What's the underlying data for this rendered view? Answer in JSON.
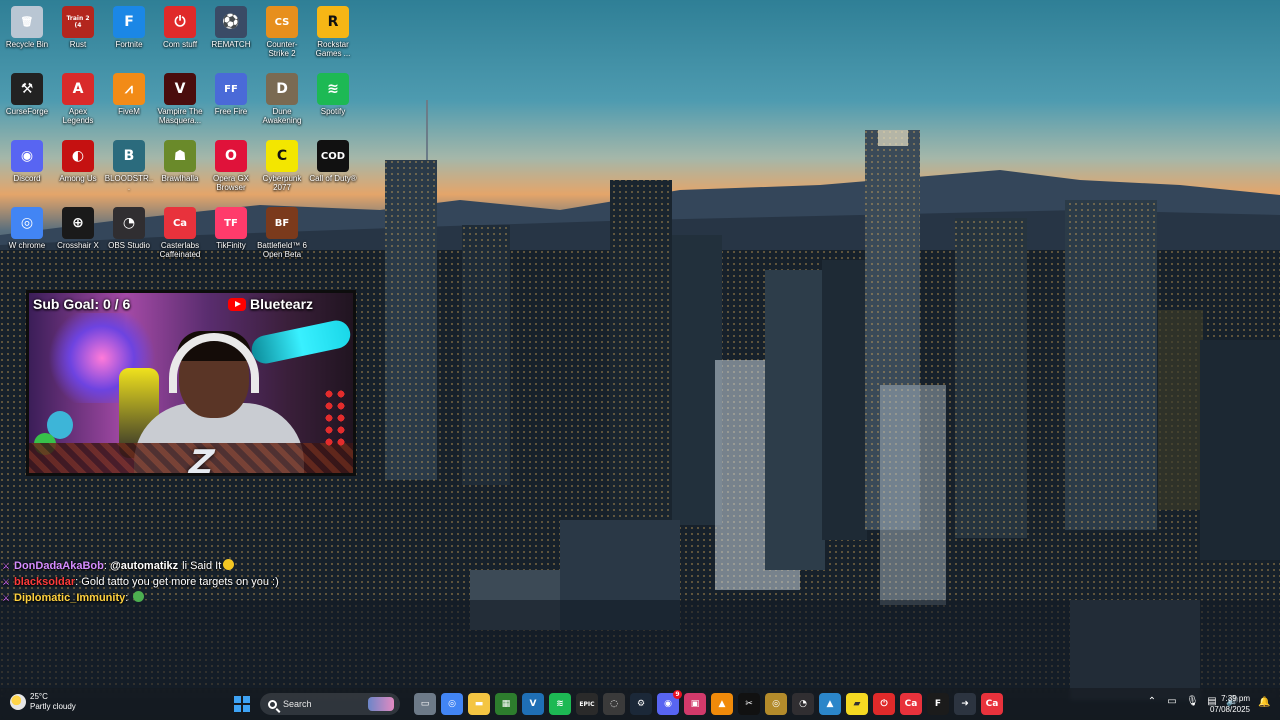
{
  "desktop": {
    "icons": [
      {
        "label": "Recycle Bin",
        "icon": "recycle-bin-icon",
        "color": "#b9c6d3",
        "glyph": "🗑",
        "shortcut": false,
        "col": 0,
        "row": 0
      },
      {
        "label": "Rust",
        "icon": "rust-icon",
        "color": "#b3261e",
        "glyph": "Train 2 (4",
        "shortcut": true,
        "col": 1,
        "row": 0
      },
      {
        "label": "Fortnite",
        "icon": "fortnite-icon",
        "color": "#1b87e6",
        "glyph": "F",
        "shortcut": true,
        "col": 2,
        "row": 0
      },
      {
        "label": "Com stuff",
        "icon": "power-icon",
        "color": "#e02a2a",
        "glyph": "⏻",
        "shortcut": false,
        "col": 3,
        "row": 0
      },
      {
        "label": "REMATCH",
        "icon": "rematch-icon",
        "color": "#3a4b66",
        "glyph": "⚽",
        "shortcut": true,
        "col": 4,
        "row": 0
      },
      {
        "label": "Counter-Strike 2",
        "icon": "counter-strike-icon",
        "color": "#e78f1d",
        "glyph": "CS",
        "shortcut": true,
        "col": 5,
        "row": 0
      },
      {
        "label": "Rockstar Games ...",
        "icon": "rockstar-icon",
        "color": "#f6b615",
        "glyph": "R",
        "shortcut": true,
        "col": 6,
        "row": 0
      },
      {
        "label": "CurseForge",
        "icon": "curseforge-icon",
        "color": "#222222",
        "glyph": "⚒",
        "shortcut": true,
        "col": 0,
        "row": 1
      },
      {
        "label": "Apex Legends",
        "icon": "apex-icon",
        "color": "#d92a2a",
        "glyph": "A",
        "shortcut": true,
        "col": 1,
        "row": 1
      },
      {
        "label": "FiveM",
        "icon": "fivem-icon",
        "color": "#f28b17",
        "glyph": "⩘",
        "shortcut": true,
        "col": 2,
        "row": 1
      },
      {
        "label": "Vampire The Masquera...",
        "icon": "vampire-icon",
        "color": "#4a0d0d",
        "glyph": "V",
        "shortcut": true,
        "col": 3,
        "row": 1
      },
      {
        "label": "Free Fire",
        "icon": "free-fire-icon",
        "color": "#4a6ad8",
        "glyph": "FF",
        "shortcut": true,
        "col": 4,
        "row": 1
      },
      {
        "label": "Dune Awakening",
        "icon": "dune-icon",
        "color": "#7a6a52",
        "glyph": "D",
        "shortcut": true,
        "col": 5,
        "row": 1
      },
      {
        "label": "Spotify",
        "icon": "spotify-icon",
        "color": "#1db954",
        "glyph": "≋",
        "shortcut": false,
        "col": 6,
        "row": 1
      },
      {
        "label": "Discord",
        "icon": "discord-icon",
        "color": "#5865f2",
        "glyph": "◉",
        "shortcut": false,
        "col": 0,
        "row": 2
      },
      {
        "label": "Among Us",
        "icon": "among-us-icon",
        "color": "#c51111",
        "glyph": "◐",
        "shortcut": true,
        "col": 1,
        "row": 2
      },
      {
        "label": "BLOODSTR...",
        "icon": "bloodstrike-icon",
        "color": "#2b6b7d",
        "glyph": "B",
        "shortcut": true,
        "col": 2,
        "row": 2
      },
      {
        "label": "Brawlhalla",
        "icon": "brawlhalla-icon",
        "color": "#6a8a2a",
        "glyph": "☗",
        "shortcut": true,
        "col": 3,
        "row": 2
      },
      {
        "label": "Opera GX Browser",
        "icon": "opera-gx-icon",
        "color": "#e0123a",
        "glyph": "O",
        "shortcut": true,
        "col": 4,
        "row": 2
      },
      {
        "label": "Cyberpunk 2077",
        "icon": "cyberpunk-icon",
        "color": "#f3e600",
        "glyph": "C",
        "shortcut": true,
        "col": 5,
        "row": 2
      },
      {
        "label": "Call of Duty®",
        "icon": "call-of-duty-icon",
        "color": "#111111",
        "glyph": "COD",
        "shortcut": true,
        "col": 6,
        "row": 2
      },
      {
        "label": "W chrome",
        "icon": "chrome-icon",
        "color": "#4285f4",
        "glyph": "◎",
        "shortcut": false,
        "col": 0,
        "row": 3
      },
      {
        "label": "Crosshair X",
        "icon": "crosshair-icon",
        "color": "#1a1a1a",
        "glyph": "⊕",
        "shortcut": true,
        "col": 1,
        "row": 3
      },
      {
        "label": "OBS Studio",
        "icon": "obs-icon",
        "color": "#302e31",
        "glyph": "◔",
        "shortcut": true,
        "col": 2,
        "row": 3
      },
      {
        "label": "Casterlabs Caffeinated",
        "icon": "casterlabs-icon",
        "color": "#e8323c",
        "glyph": "Ca",
        "shortcut": true,
        "col": 3,
        "row": 3
      },
      {
        "label": "TikFinity",
        "icon": "tikfinity-icon",
        "color": "#ff3b6b",
        "glyph": "TF",
        "shortcut": true,
        "col": 4,
        "row": 3
      },
      {
        "label": "Battlefield™ 6 Open Beta",
        "icon": "battlefield-icon",
        "color": "#7b3a1c",
        "glyph": "BF",
        "shortcut": true,
        "col": 5,
        "row": 3
      }
    ]
  },
  "stream": {
    "sub_goal": "Sub Goal: 0 / 6",
    "channel": "Bluetearz",
    "logo_letter": "Z"
  },
  "chat": [
    {
      "user": "DonDadaAkaBob",
      "user_color": "#d48cff",
      "message": "@automatikz",
      "message_bold": true,
      "extra": "li Said It",
      "emoji": "grinning",
      "badge": "⚔"
    },
    {
      "user": "blacksoldar",
      "user_color": "#ff3b3b",
      "message": "Gold tatto you get more targets on you :)",
      "message_bold": false,
      "extra": "",
      "emoji": "",
      "badge": "⚔"
    },
    {
      "user": "Diplomatic_Immunity",
      "user_color": "#ffd23f",
      "message": "",
      "message_bold": false,
      "extra": "",
      "emoji": "green",
      "badge": "⚔"
    }
  ],
  "taskbar": {
    "weather_temp": "25°C",
    "weather_desc": "Partly cloudy",
    "search_label": "Search",
    "apps": [
      {
        "icon": "task-view-icon",
        "color": "#6d7a88",
        "glyph": "▭",
        "badge": ""
      },
      {
        "icon": "chrome-icon",
        "color": "#4285f4",
        "glyph": "◎",
        "badge": ""
      },
      {
        "icon": "file-explorer-icon",
        "color": "#f4c542",
        "glyph": "▬",
        "badge": ""
      },
      {
        "icon": "terminal-icon",
        "color": "#2d7d2d",
        "glyph": "▦",
        "badge": ""
      },
      {
        "icon": "vscode-icon",
        "color": "#1f6fb5",
        "glyph": "V",
        "badge": ""
      },
      {
        "icon": "spotify-icon",
        "color": "#1db954",
        "glyph": "≋",
        "badge": ""
      },
      {
        "icon": "epic-games-icon",
        "color": "#2a2a2a",
        "glyph": "EPIC",
        "badge": ""
      },
      {
        "icon": "settings-ring-icon",
        "color": "#3a3a3a",
        "glyph": "◌",
        "badge": ""
      },
      {
        "icon": "steam-icon",
        "color": "#1b2838",
        "glyph": "⚙",
        "badge": ""
      },
      {
        "icon": "discord-icon",
        "color": "#5865f2",
        "glyph": "◉",
        "badge": "9"
      },
      {
        "icon": "photos-icon",
        "color": "#d23a6b",
        "glyph": "▣",
        "badge": ""
      },
      {
        "icon": "vlc-icon",
        "color": "#f08a0a",
        "glyph": "▲",
        "badge": ""
      },
      {
        "icon": "capcut-icon",
        "color": "#111111",
        "glyph": "✂",
        "badge": ""
      },
      {
        "icon": "gold-ring-icon",
        "color": "#b38b2b",
        "glyph": "◎",
        "badge": ""
      },
      {
        "icon": "obs-icon",
        "color": "#302e31",
        "glyph": "◔",
        "badge": ""
      },
      {
        "icon": "gallery-icon",
        "color": "#2b86c9",
        "glyph": "▲",
        "badge": ""
      },
      {
        "icon": "sticky-notes-icon",
        "color": "#f5d922",
        "glyph": "▰",
        "badge": ""
      },
      {
        "icon": "power-icon",
        "color": "#e02a2a",
        "glyph": "⏻",
        "badge": ""
      },
      {
        "icon": "casterlabs-icon",
        "color": "#e8323c",
        "glyph": "Ca",
        "badge": ""
      },
      {
        "icon": "fortnite-icon",
        "color": "#1b1b1b",
        "glyph": "F",
        "badge": ""
      },
      {
        "icon": "arrow-icon",
        "color": "#2c3440",
        "glyph": "➜",
        "badge": ""
      },
      {
        "icon": "casterlabs-alt-icon",
        "color": "#e8323c",
        "glyph": "Ca",
        "badge": ""
      }
    ],
    "tray": [
      {
        "icon": "chevron-up-icon",
        "glyph": "⌃"
      },
      {
        "icon": "usb-icon",
        "glyph": "▭"
      },
      {
        "icon": "microphone-icon",
        "glyph": "🎙"
      },
      {
        "icon": "network-icon",
        "glyph": "▤"
      },
      {
        "icon": "volume-icon",
        "glyph": "🔊"
      }
    ],
    "time": "7:39 pm",
    "date": "07/08/2025"
  }
}
